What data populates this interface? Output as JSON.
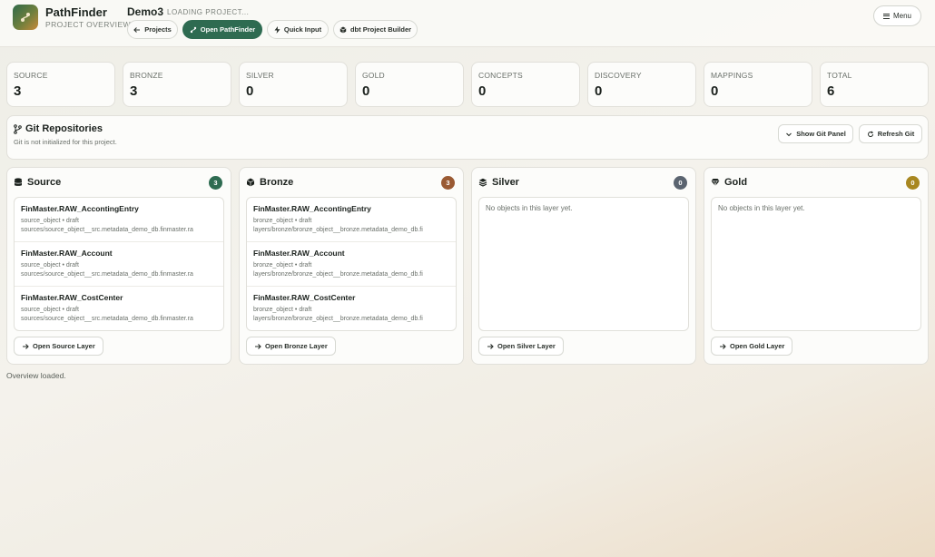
{
  "app": {
    "name": "PathFinder",
    "subtitle": "PROJECT OVERVIEW",
    "project_name": "Demo3",
    "project_status": "LOADING PROJECT..."
  },
  "nav": {
    "projects": "Projects",
    "open_pathfinder": "Open PathFinder",
    "quick_input": "Quick Input",
    "dbt_builder": "dbt Project Builder",
    "menu": "Menu"
  },
  "stats": [
    {
      "label": "SOURCE",
      "value": "3"
    },
    {
      "label": "BRONZE",
      "value": "3"
    },
    {
      "label": "SILVER",
      "value": "0"
    },
    {
      "label": "GOLD",
      "value": "0"
    },
    {
      "label": "CONCEPTS",
      "value": "0"
    },
    {
      "label": "DISCOVERY",
      "value": "0"
    },
    {
      "label": "MAPPINGS",
      "value": "0"
    },
    {
      "label": "TOTAL",
      "value": "6"
    }
  ],
  "git": {
    "title": "Git Repositories",
    "subtitle": "Git is not initialized for this project.",
    "show_panel": "Show Git Panel",
    "refresh": "Refresh Git"
  },
  "layers": {
    "source": {
      "title": "Source",
      "count": "3",
      "badge_color": "#2e6b51",
      "open_label": "Open Source Layer",
      "items": [
        {
          "name": "FinMaster.RAW_AccontingEntry",
          "meta": "source_object • draft",
          "path": "sources/source_object__src.metadata_demo_db.finmaster.ra"
        },
        {
          "name": "FinMaster.RAW_Account",
          "meta": "source_object • draft",
          "path": "sources/source_object__src.metadata_demo_db.finmaster.ra"
        },
        {
          "name": "FinMaster.RAW_CostCenter",
          "meta": "source_object • draft",
          "path": "sources/source_object__src.metadata_demo_db.finmaster.ra"
        }
      ]
    },
    "bronze": {
      "title": "Bronze",
      "count": "3",
      "badge_color": "#9a5a33",
      "open_label": "Open Bronze Layer",
      "items": [
        {
          "name": "FinMaster.RAW_AccontingEntry",
          "meta": "bronze_object • draft",
          "path": "layers/bronze/bronze_object__bronze.metadata_demo_db.fi"
        },
        {
          "name": "FinMaster.RAW_Account",
          "meta": "bronze_object • draft",
          "path": "layers/bronze/bronze_object__bronze.metadata_demo_db.fi"
        },
        {
          "name": "FinMaster.RAW_CostCenter",
          "meta": "bronze_object • draft",
          "path": "layers/bronze/bronze_object__bronze.metadata_demo_db.fi"
        }
      ]
    },
    "silver": {
      "title": "Silver",
      "count": "0",
      "badge_color": "#5b6470",
      "open_label": "Open Silver Layer",
      "empty_text": "No objects in this layer yet."
    },
    "gold": {
      "title": "Gold",
      "count": "0",
      "badge_color": "#a88720",
      "open_label": "Open Gold Layer",
      "empty_text": "No objects in this layer yet."
    }
  },
  "status": "Overview loaded.",
  "icons": {
    "logo": "pathfinder-logo-icon",
    "back": "arrow-left-icon",
    "pathfinder": "route-icon",
    "quick": "lightning-icon",
    "dbt": "cube-icon",
    "menu": "hamburger-icon",
    "git": "git-branch-icon",
    "refresh": "refresh-icon",
    "source": "database-icon",
    "bronze": "cube-icon",
    "silver": "layers-icon",
    "gold": "gem-icon",
    "open": "arrow-right-icon"
  }
}
